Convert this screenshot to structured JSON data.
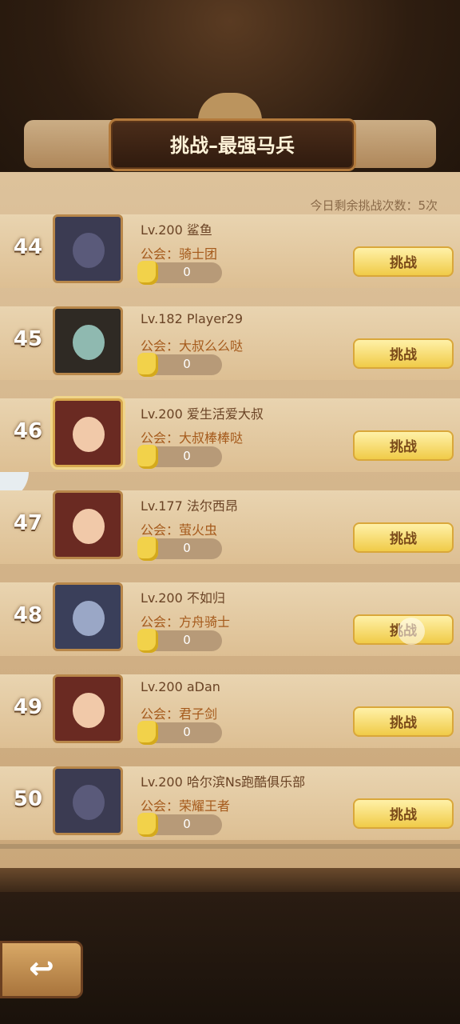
{
  "title": "挑战–最强马兵",
  "remaining_text": "今日剩余挑战次数：5次",
  "challenge_label": "挑战",
  "guild_prefix": "公会：",
  "rows": [
    {
      "rank": "44",
      "level": "Lv.200",
      "name": "鲨鱼",
      "guild": "骑士团",
      "score": "0",
      "portrait_colors": [
        "#3b3b52",
        "#5a5a7a"
      ],
      "gold_frame": false
    },
    {
      "rank": "45",
      "level": "Lv.182",
      "name": "Player29",
      "guild": "大叔么么哒",
      "score": "0",
      "portrait_colors": [
        "#2f2a24",
        "#8fb9b0"
      ],
      "gold_frame": false
    },
    {
      "rank": "46",
      "level": "Lv.200",
      "name": "爱生活爱大叔",
      "guild": "大叔棒棒哒",
      "score": "0",
      "portrait_colors": [
        "#6a2a22",
        "#f1c9a9"
      ],
      "gold_frame": true
    },
    {
      "rank": "47",
      "level": "Lv.177",
      "name": "法尔西昂",
      "guild": "萤火虫",
      "score": "0",
      "portrait_colors": [
        "#6a2a22",
        "#f1c9a9"
      ],
      "gold_frame": false
    },
    {
      "rank": "48",
      "level": "Lv.200",
      "name": "不如归",
      "guild": "方舟骑士",
      "score": "0",
      "portrait_colors": [
        "#3a3f5a",
        "#9aa7c6"
      ],
      "gold_frame": false
    },
    {
      "rank": "49",
      "level": "Lv.200",
      "name": "aDan",
      "guild": "君子剑",
      "score": "0",
      "portrait_colors": [
        "#6a2a22",
        "#f1c9a9"
      ],
      "gold_frame": false
    },
    {
      "rank": "50",
      "level": "Lv.200",
      "name": "哈尔滨Ns跑酷俱乐部",
      "guild": "荣耀王者",
      "score": "0",
      "portrait_colors": [
        "#3b3b52",
        "#5a5a7a"
      ],
      "gold_frame": false
    }
  ],
  "back_icon": "↩"
}
